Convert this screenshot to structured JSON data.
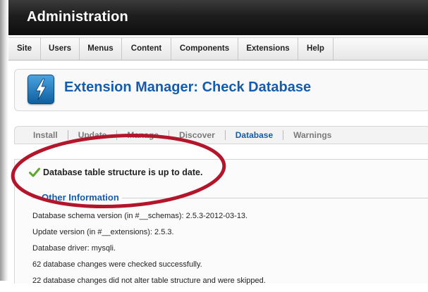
{
  "header": {
    "title": "Administration"
  },
  "menu": {
    "items": [
      {
        "label": "Site"
      },
      {
        "label": "Users"
      },
      {
        "label": "Menus"
      },
      {
        "label": "Content"
      },
      {
        "label": "Components"
      },
      {
        "label": "Extensions"
      },
      {
        "label": "Help"
      }
    ]
  },
  "title_panel": {
    "title": "Extension Manager: Check Database",
    "icon": "lightning-bolt-icon"
  },
  "tabs": [
    {
      "label": "Install",
      "active": false
    },
    {
      "label": "Update",
      "active": false
    },
    {
      "label": "Manage",
      "active": false
    },
    {
      "label": "Discover",
      "active": false
    },
    {
      "label": "Database",
      "active": true
    },
    {
      "label": "Warnings",
      "active": false
    }
  ],
  "status": {
    "message": "Database table structure is up to date.",
    "icon": "check-icon"
  },
  "other_information": {
    "legend": "Other Information",
    "lines": [
      "Database schema version (in #__schemas): 2.5.3-2012-03-13.",
      "Update version (in #__extensions): 2.5.3.",
      "Database driver: mysqli.",
      "62 database changes were checked successfully.",
      "22 database changes did not alter table structure and were skipped."
    ]
  },
  "colors": {
    "accent": "#135cae",
    "header_bg": "#1a1a1a",
    "annotation": "#b3152b",
    "check": "#5aa82c"
  }
}
